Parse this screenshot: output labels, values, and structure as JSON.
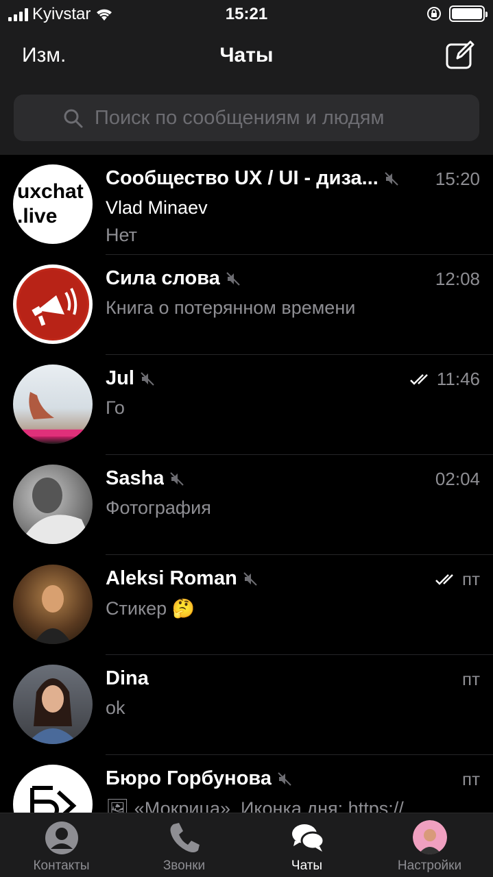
{
  "status_bar": {
    "carrier": "Kyivstar",
    "time": "15:21"
  },
  "navbar": {
    "edit_label": "Изм.",
    "title": "Чаты"
  },
  "search": {
    "placeholder": "Поиск по сообщениям и людям"
  },
  "chats": [
    {
      "name": "Сообщество UX / UI - диза...",
      "muted": true,
      "time": "15:20",
      "sender": "Vlad Minaev",
      "preview": "Нет",
      "avatar_text": [
        "uxchat",
        ".live"
      ]
    },
    {
      "name": "Сила слова",
      "muted": true,
      "time": "12:08",
      "preview": "Книга о потерянном времени"
    },
    {
      "name": "Jul",
      "muted": true,
      "time": "11:46",
      "read": true,
      "preview": "Го"
    },
    {
      "name": "Sasha",
      "muted": true,
      "time": "02:04",
      "preview": "Фотография"
    },
    {
      "name": "Aleksi Roman",
      "muted": true,
      "time": "пт",
      "read": true,
      "preview": "Стикер 🤔"
    },
    {
      "name": "Dina",
      "muted": false,
      "time": "пт",
      "preview": "ok"
    },
    {
      "name": "Бюро Горбунова",
      "muted": true,
      "time": "пт",
      "preview": "🖼 «Мокрица». Иконка дня: https://"
    }
  ],
  "tabbar": {
    "tabs": [
      {
        "label": "Контакты",
        "icon": "person-icon"
      },
      {
        "label": "Звонки",
        "icon": "phone-icon"
      },
      {
        "label": "Чаты",
        "icon": "chat-bubbles-icon",
        "active": true
      },
      {
        "label": "Настройки",
        "icon": "profile-avatar"
      }
    ]
  }
}
